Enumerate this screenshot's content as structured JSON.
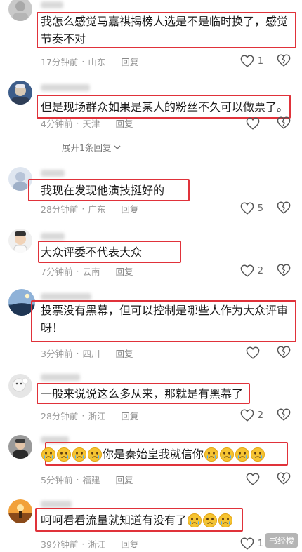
{
  "comments": [
    {
      "text": "我怎么感觉马嘉祺揭榜人选是不是临时换了，感觉节奏不对",
      "time": "17分钟前",
      "region": "山东",
      "reply": "回复",
      "likes": "1"
    },
    {
      "text": "但是现场群众如果是某人的粉丝不久可以做票了。",
      "time": "4分钟前",
      "region": "天津",
      "reply": "回复",
      "likes": ""
    },
    {
      "text": "我现在发现他演技挺好的",
      "time": "28分钟前",
      "region": "广东",
      "reply": "回复",
      "likes": "5"
    },
    {
      "text": "大众评委不代表大众",
      "time": "7分钟前",
      "region": "云南",
      "reply": "回复",
      "likes": "2"
    },
    {
      "text": "投票没有黑幕，但可以控制是哪些人作为大众评审呀！",
      "time": "3分钟前",
      "region": "四川",
      "reply": "回复",
      "likes": ""
    },
    {
      "text": "一般来说说这么多从来，那就是有黑幕了",
      "time": "28分钟前",
      "region": "浙江",
      "reply": "回复",
      "likes": "2"
    },
    {
      "text": "你是秦始皇我就信你",
      "time": "5分钟前",
      "region": "福建",
      "reply": "回复",
      "likes": ""
    },
    {
      "text": "呵呵看看流量就知道有没有了",
      "time": "39分钟前",
      "region": "浙江",
      "reply": "回复",
      "likes": "1"
    }
  ],
  "expand_replies": "展开1条回复",
  "dot": "·",
  "watermark": "书经楼",
  "colors": {
    "highlight_box": "#e0323a",
    "meta_text": "#9a9a9a"
  },
  "icons": [
    "heart-icon",
    "broken-heart-icon",
    "chevron-down-icon",
    "crying-emoji-icon"
  ]
}
